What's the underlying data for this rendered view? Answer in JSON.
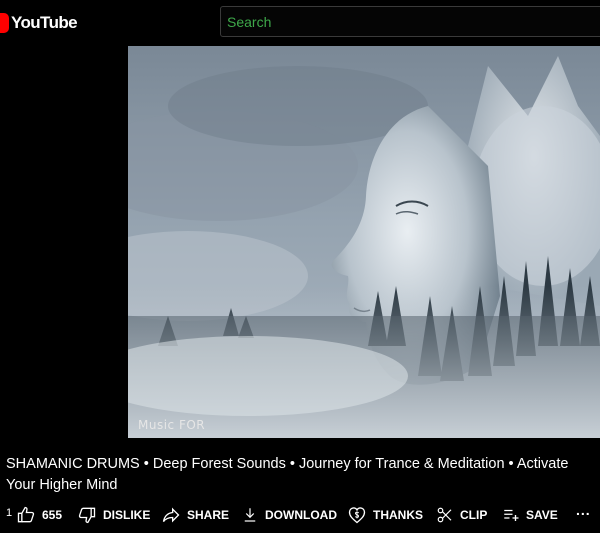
{
  "header": {
    "logo_text": "YouTube",
    "search_placeholder": "Search"
  },
  "player": {
    "watermark": "Music FOR"
  },
  "video": {
    "title": "SHAMANIC DRUMS • Deep Forest Sounds • Journey for Trance & Meditation • Activate Your Higher Mind"
  },
  "actions": {
    "prefix_number": "1",
    "like_count": "655",
    "dislike_label": "DISLIKE",
    "share_label": "SHARE",
    "download_label": "DOWNLOAD",
    "thanks_label": "THANKS",
    "clip_label": "CLIP",
    "save_label": "SAVE",
    "more_label": "..."
  },
  "icons": {
    "logo": "youtube-play-icon",
    "like": "thumbs-up-icon",
    "dislike": "thumbs-down-icon",
    "share": "share-arrow-icon",
    "download": "download-arrow-icon",
    "thanks": "thanks-heart-icon",
    "clip": "scissors-icon",
    "save": "playlist-add-icon",
    "more": "more-horizontal-icon"
  },
  "colors": {
    "background": "#000000",
    "logo_red": "#ff0000",
    "search_text": "#3ea84a",
    "text": "#ffffff"
  }
}
